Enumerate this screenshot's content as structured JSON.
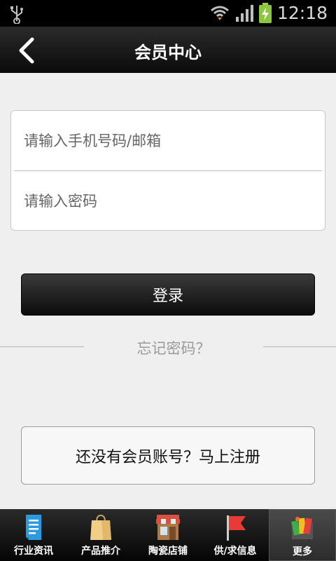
{
  "status_bar": {
    "time": "12:18",
    "icons": [
      "usb-icon",
      "wifi-icon",
      "signal-icon",
      "battery-charging-icon"
    ]
  },
  "header": {
    "title": "会员中心",
    "back_icon": "chevron-left-icon"
  },
  "login_form": {
    "account_placeholder": "请输入手机号码/邮箱",
    "password_placeholder": "请输入密码",
    "login_label": "登录",
    "forgot_label": "忘记密码？",
    "register_label": "还没有会员账号？马上注册"
  },
  "bottom_nav": {
    "items": [
      {
        "label": "行业资讯",
        "icon": "document-icon",
        "active": false
      },
      {
        "label": "产品推介",
        "icon": "shopping-bag-icon",
        "active": false
      },
      {
        "label": "陶瓷店铺",
        "icon": "store-icon",
        "active": false
      },
      {
        "label": "供/求信息",
        "icon": "flag-icon",
        "active": false
      },
      {
        "label": "更多",
        "icon": "more-cards-icon",
        "active": true
      }
    ]
  },
  "colors": {
    "background": "#efefef",
    "header": "#111111",
    "button_dark": "#1a1a1a",
    "muted_text": "#9a9a9a"
  }
}
